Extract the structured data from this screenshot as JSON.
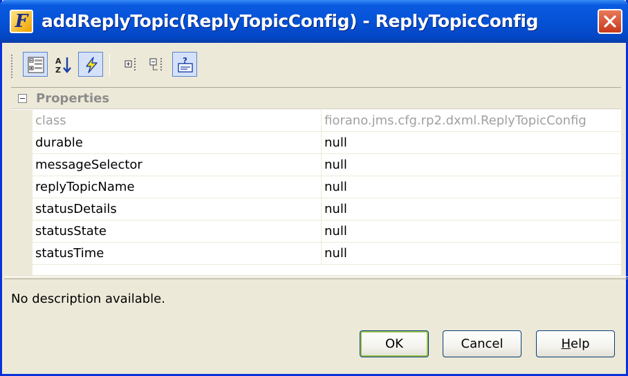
{
  "window": {
    "title": "addReplyTopic(ReplyTopicConfig) - ReplyTopicConfig",
    "app_icon_letter": "F",
    "colors": {
      "titlebar": "#0552d6",
      "close": "#c8381a",
      "face": "#ece9d8",
      "readonly_text": "#a0a0a0"
    }
  },
  "toolbar": {
    "buttons": [
      {
        "icon": "categorized-view-icon",
        "toggled": true
      },
      {
        "icon": "sort-alphabetical-icon",
        "toggled": false
      },
      {
        "icon": "lightning-icon",
        "toggled": true
      },
      {
        "icon": "expand-all-icon",
        "toggled": false
      },
      {
        "icon": "collapse-all-icon",
        "toggled": false
      },
      {
        "icon": "help-description-icon",
        "toggled": true
      }
    ]
  },
  "properties": {
    "category": "Properties",
    "rows": [
      {
        "name": "class",
        "value": "fiorano.jms.cfg.rp2.dxml.ReplyTopicConfig",
        "readonly": true
      },
      {
        "name": "durable",
        "value": "null",
        "readonly": false
      },
      {
        "name": "messageSelector",
        "value": "null",
        "readonly": false
      },
      {
        "name": "replyTopicName",
        "value": "null",
        "readonly": false
      },
      {
        "name": "statusDetails",
        "value": "null",
        "readonly": false
      },
      {
        "name": "statusState",
        "value": "null",
        "readonly": false
      },
      {
        "name": "statusTime",
        "value": "null",
        "readonly": false
      }
    ]
  },
  "description": "No description available.",
  "buttons": {
    "ok": "OK",
    "cancel": "Cancel",
    "help_prefix": "",
    "help_mnemonic": "H",
    "help_rest": "elp"
  }
}
